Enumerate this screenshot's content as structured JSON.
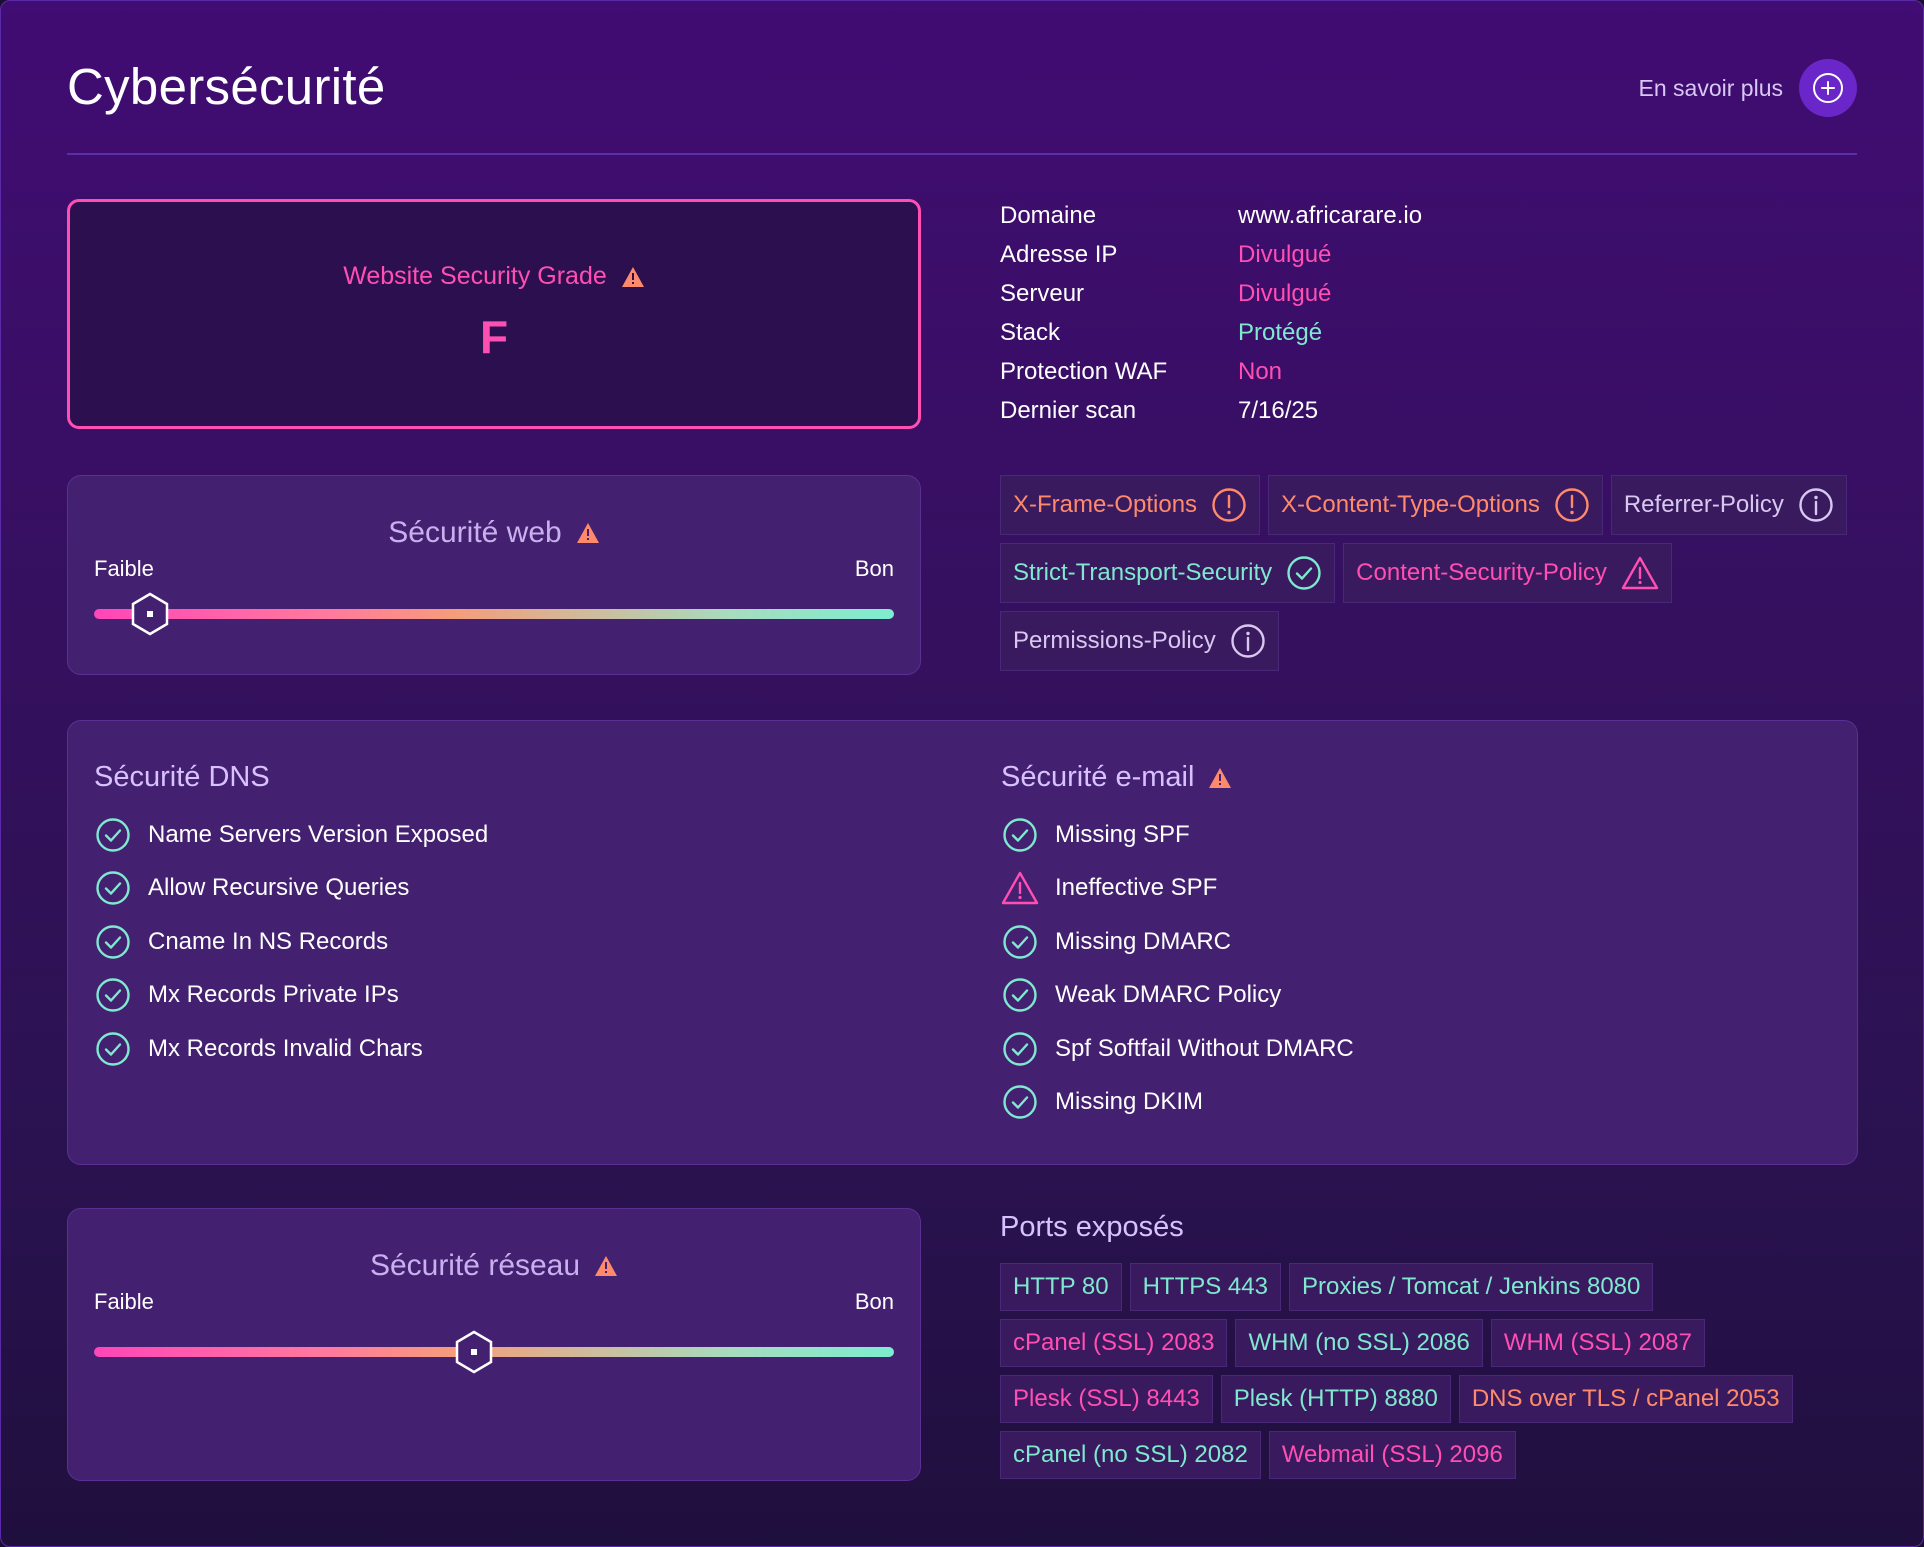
{
  "header": {
    "title": "Cybersécurité",
    "learn_more": "En savoir plus"
  },
  "grade": {
    "label": "Website Security Grade",
    "value": "F"
  },
  "web_security": {
    "title": "Sécurité web",
    "low": "Faible",
    "high": "Bon",
    "level": 0.07
  },
  "info": [
    {
      "key": "Domaine",
      "value": "www.africarare.io",
      "color": "#ffffff"
    },
    {
      "key": "Adresse IP",
      "value": "Divulgué",
      "color": "#ff4fb2"
    },
    {
      "key": "Serveur",
      "value": "Divulgué",
      "color": "#ff4fb2"
    },
    {
      "key": "Stack",
      "value": "Protégé",
      "color": "#7fe8cf"
    },
    {
      "key": "Protection WAF",
      "value": "Non",
      "color": "#ff4fb2"
    },
    {
      "key": "Dernier scan",
      "value": "7/16/25",
      "color": "#ffffff"
    }
  ],
  "headers_chips": [
    {
      "label": "X-Frame-Options",
      "icon": "exclamation-circle-icon",
      "color": "#ff8a6b"
    },
    {
      "label": "X-Content-Type-Options",
      "icon": "exclamation-circle-icon",
      "color": "#ff8a6b"
    },
    {
      "label": "Referrer-Policy",
      "icon": "info-circle-icon",
      "color": "#d8c8f0"
    },
    {
      "label": "Strict-Transport-Security",
      "icon": "check-circle-icon",
      "color": "#7fe8cf"
    },
    {
      "label": "Content-Security-Policy",
      "icon": "warning-triangle-icon",
      "color": "#ff4fb2"
    },
    {
      "label": "Permissions-Policy",
      "icon": "info-circle-icon",
      "color": "#d8c8f0"
    }
  ],
  "dns": {
    "title": "Sécurité DNS",
    "items": [
      {
        "label": "Name Servers Version Exposed",
        "status": "check"
      },
      {
        "label": "Allow Recursive Queries",
        "status": "check"
      },
      {
        "label": "Cname In NS Records",
        "status": "check"
      },
      {
        "label": "Mx Records Private IPs",
        "status": "check"
      },
      {
        "label": "Mx Records Invalid Chars",
        "status": "check"
      }
    ]
  },
  "email": {
    "title": "Sécurité e-mail",
    "items": [
      {
        "label": "Missing SPF",
        "status": "check"
      },
      {
        "label": "Ineffective SPF",
        "status": "warning"
      },
      {
        "label": "Missing DMARC",
        "status": "check"
      },
      {
        "label": "Weak DMARC Policy",
        "status": "check"
      },
      {
        "label": "Spf Softfail Without DMARC",
        "status": "check"
      },
      {
        "label": "Missing DKIM",
        "status": "check"
      }
    ]
  },
  "network_security": {
    "title": "Sécurité réseau",
    "low": "Faible",
    "high": "Bon",
    "level": 0.475
  },
  "ports": {
    "title": "Ports exposés",
    "items": [
      {
        "label": "HTTP 80",
        "color": "#7fe8cf"
      },
      {
        "label": "HTTPS 443",
        "color": "#7fe8cf"
      },
      {
        "label": "Proxies / Tomcat / Jenkins 8080",
        "color": "#7fe8cf"
      },
      {
        "label": "cPanel (SSL) 2083",
        "color": "#ff4fb2"
      },
      {
        "label": "WHM (no SSL) 2086",
        "color": "#7fe8cf"
      },
      {
        "label": "WHM (SSL) 2087",
        "color": "#ff4fb2"
      },
      {
        "label": "Plesk (SSL) 8443",
        "color": "#ff4fb2"
      },
      {
        "label": "Plesk (HTTP) 8880",
        "color": "#7fe8cf"
      },
      {
        "label": "DNS over TLS / cPanel 2053",
        "color": "#ff8a6b"
      },
      {
        "label": "cPanel (no SSL) 2082",
        "color": "#7fe8cf"
      },
      {
        "label": "Webmail (SSL) 2096",
        "color": "#ff4fb2"
      }
    ]
  },
  "colors": {
    "accent_pink": "#ff4fb2",
    "accent_teal": "#7fe8cf",
    "accent_orange": "#ff8a6b",
    "warning_triangle": "#ff8a6b"
  }
}
